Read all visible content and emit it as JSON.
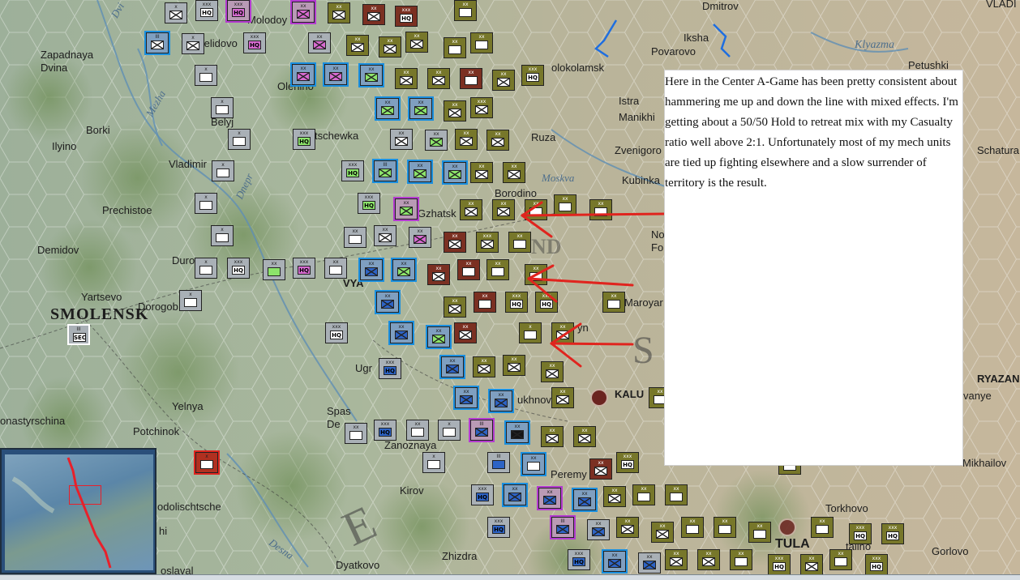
{
  "map": {
    "place_names": [
      {
        "id": "zapadnaya-dvina",
        "text": "Zapadnaya\nDvina"
      },
      {
        "id": "molodoy-tud",
        "text": "Molodoy Tud"
      },
      {
        "id": "selidovo",
        "text": "Selidovo"
      },
      {
        "id": "olenino",
        "text": "Olenino"
      },
      {
        "id": "belyj",
        "text": "Belyj"
      },
      {
        "id": "borki",
        "text": "Borki"
      },
      {
        "id": "ilyino",
        "text": "Ilyino"
      },
      {
        "id": "tschewka",
        "text": "tschewka"
      },
      {
        "id": "vladimir",
        "text": "Vladimir"
      },
      {
        "id": "prechistoe",
        "text": "Prechistoe"
      },
      {
        "id": "demidov",
        "text": "Demidov"
      },
      {
        "id": "dur",
        "text": "Duro"
      },
      {
        "id": "yartsevo",
        "text": "Yartsevo"
      },
      {
        "id": "dorogobuzh",
        "text": "Dorogob"
      },
      {
        "id": "smolensk",
        "text": "SMOLENSK"
      },
      {
        "id": "ugra",
        "text": "Ugr"
      },
      {
        "id": "yelnya",
        "text": "Yelnya"
      },
      {
        "id": "spas-demensk",
        "text": "Spas\nDe"
      },
      {
        "id": "monastyrschina",
        "text": "onastyrschina"
      },
      {
        "id": "potchinok",
        "text": "Potchinok"
      },
      {
        "id": "zanoznaya",
        "text": "Zanoznaya"
      },
      {
        "id": "kirov",
        "text": "Kirov"
      },
      {
        "id": "podolischtsche",
        "text": "odolischtsche"
      },
      {
        "id": "hi",
        "text": "hi"
      },
      {
        "id": "roslaval",
        "text": "oslaval"
      },
      {
        "id": "dyatkovo",
        "text": "Dyatkovo"
      },
      {
        "id": "zhizdra",
        "text": "Zhizdra"
      },
      {
        "id": "dmitrov",
        "text": "Dmitrov"
      },
      {
        "id": "iksha",
        "text": "Iksha"
      },
      {
        "id": "povarovo",
        "text": "Povarovo"
      },
      {
        "id": "petushki",
        "text": "Petushki"
      },
      {
        "id": "volokolamsk",
        "text": "olokolamsk"
      },
      {
        "id": "istra",
        "text": "Istra"
      },
      {
        "id": "manikhino",
        "text": "Manikhi"
      },
      {
        "id": "ruza",
        "text": "Ruza"
      },
      {
        "id": "zvenigorod",
        "text": "Zvenigoro"
      },
      {
        "id": "kubinka",
        "text": "Kubinka"
      },
      {
        "id": "borodino",
        "text": "Borodino"
      },
      {
        "id": "gzhatsk",
        "text": "Gzhatsk"
      },
      {
        "id": "vyazma",
        "text": "VYA"
      },
      {
        "id": "maroyar",
        "text": "Maroyar"
      },
      {
        "id": "yukhnov",
        "text": "ukhnov"
      },
      {
        "id": "kaluga",
        "text": "KALU"
      },
      {
        "id": "peremyshl",
        "text": "Peremy"
      },
      {
        "id": "torkhovo",
        "text": "Torkhovo"
      },
      {
        "id": "mikhailov",
        "text": "Mikhailov"
      },
      {
        "id": "ryazan",
        "text": "RYAZAN"
      },
      {
        "id": "vanye",
        "text": "vanye"
      },
      {
        "id": "schatura",
        "text": "Schatura"
      },
      {
        "id": "gorlovo",
        "text": "Gorlovo"
      },
      {
        "id": "tula",
        "text": "TULA"
      },
      {
        "id": "stalino",
        "text": "talino"
      },
      {
        "id": "no-fo",
        "text": "No\nFo"
      },
      {
        "id": "vladi",
        "text": "VLADI"
      },
      {
        "id": "ryn",
        "text": "yn"
      }
    ],
    "rivers": [
      {
        "id": "mezha",
        "text": "Mezha"
      },
      {
        "id": "dnepr",
        "text": "Dnepr"
      },
      {
        "id": "moskva",
        "text": "Moskva"
      },
      {
        "id": "klyazma",
        "text": "Klyazma"
      },
      {
        "id": "desna",
        "text": "Desna"
      },
      {
        "id": "dvina",
        "text": "Dvi"
      }
    ],
    "regions": [
      {
        "id": "region-e",
        "text": "E"
      },
      {
        "id": "region-s",
        "text": "S"
      },
      {
        "id": "region-nd",
        "text": "ND"
      }
    ],
    "counter_labels": {
      "hq": "HQ",
      "sec": "SEC",
      "xx": "xx",
      "xxx": "xxx",
      "x": "x",
      "iii": "III"
    },
    "colors": {
      "german": "#77772a",
      "german_red": "#7b3022",
      "soviet_blue": "#7f9fc0",
      "soviet_grey": "#a9b0b6",
      "soviet_highlight": "#1a8fe0",
      "arrow": "#e0241e"
    }
  },
  "commentary": {
    "text": "Here in the Center A-Game has been pretty consistent about hammering me up and down the line with mixed effects. I'm getting about a 50/50 Hold to retreat mix with my Casualty ratio well above 2:1. Unfortunately most of my mech units are tied up fighting elsewhere and a slow surrender of territory is the result."
  },
  "minimap": {
    "icon": "world-minimap-icon"
  }
}
